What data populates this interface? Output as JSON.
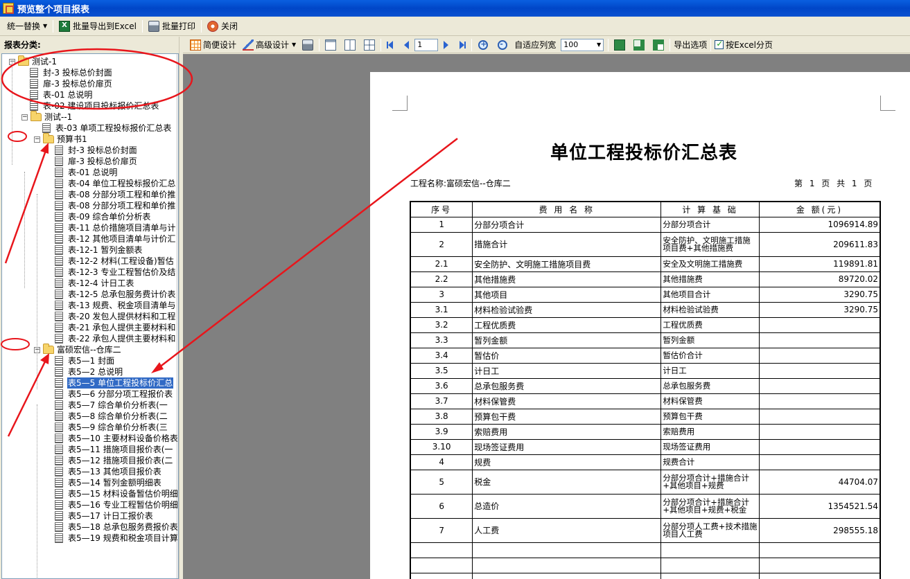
{
  "window": {
    "title": "预览整个项目报表"
  },
  "toolbar": {
    "replace_label": "统一替换",
    "export_label": "批量导出到Excel",
    "print_label": "批量打印",
    "close_label": "关闭"
  },
  "left": {
    "header": "报表分类:",
    "tree": [
      {
        "label": "测试-1",
        "level": 0,
        "type": "folder"
      },
      {
        "label": "封-3 投标总价封面",
        "level": 1,
        "type": "doc"
      },
      {
        "label": "扉-3 投标总价扉页",
        "level": 1,
        "type": "doc"
      },
      {
        "label": "表-01 总说明",
        "level": 1,
        "type": "doc"
      },
      {
        "label": "表-02 建设项目投标报价汇总表",
        "level": 1,
        "type": "doc"
      },
      {
        "label": "测试--1",
        "level": 1,
        "type": "folder"
      },
      {
        "label": "表-03 单项工程投标报价汇总表",
        "level": 2,
        "type": "doc"
      },
      {
        "label": "预算书1",
        "level": 2,
        "type": "folder"
      },
      {
        "label": "封-3 投标总价封面",
        "level": 3,
        "type": "doc"
      },
      {
        "label": "扉-3 投标总价扉页",
        "level": 3,
        "type": "doc"
      },
      {
        "label": "表-01 总说明",
        "level": 3,
        "type": "doc"
      },
      {
        "label": "表-04 单位工程投标报价汇总",
        "level": 3,
        "type": "doc"
      },
      {
        "label": "表-08 分部分项工程和单价推",
        "level": 3,
        "type": "doc"
      },
      {
        "label": "表-08 分部分项工程和单价推",
        "level": 3,
        "type": "doc"
      },
      {
        "label": "表-09 综合单价分析表",
        "level": 3,
        "type": "doc"
      },
      {
        "label": "表-11 总价措施项目清单与计",
        "level": 3,
        "type": "doc"
      },
      {
        "label": "表-12 其他项目清单与计价汇",
        "level": 3,
        "type": "doc"
      },
      {
        "label": "表-12-1 暂列金额表",
        "level": 3,
        "type": "doc"
      },
      {
        "label": "表-12-2 材料(工程设备)暂估",
        "level": 3,
        "type": "doc"
      },
      {
        "label": "表-12-3 专业工程暂估价及结",
        "level": 3,
        "type": "doc"
      },
      {
        "label": "表-12-4 计日工表",
        "level": 3,
        "type": "doc"
      },
      {
        "label": "表-12-5 总承包服务费计价表",
        "level": 3,
        "type": "doc"
      },
      {
        "label": "表-13 规费、税金项目清单与",
        "level": 3,
        "type": "doc"
      },
      {
        "label": "表-20 发包人提供材料和工程",
        "level": 3,
        "type": "doc"
      },
      {
        "label": "表-21 承包人提供主要材料和",
        "level": 3,
        "type": "doc"
      },
      {
        "label": "表-22 承包人提供主要材料和",
        "level": 3,
        "type": "doc"
      },
      {
        "label": "富硕宏信--仓库二",
        "level": 2,
        "type": "folder"
      },
      {
        "label": "表5—1 封面",
        "level": 3,
        "type": "doc"
      },
      {
        "label": "表5—2 总说明",
        "level": 3,
        "type": "doc"
      },
      {
        "label": "表5—5 单位工程投标价汇总",
        "level": 3,
        "type": "doc",
        "selected": true
      },
      {
        "label": "表5—6 分部分项工程报价表",
        "level": 3,
        "type": "doc"
      },
      {
        "label": "表5—7 综合单价分析表(一",
        "level": 3,
        "type": "doc"
      },
      {
        "label": "表5—8 综合单价分析表(二",
        "level": 3,
        "type": "doc"
      },
      {
        "label": "表5—9 综合单价分析表(三",
        "level": 3,
        "type": "doc"
      },
      {
        "label": "表5—10 主要材料设备价格表",
        "level": 3,
        "type": "doc"
      },
      {
        "label": "表5—11 措施项目报价表(一",
        "level": 3,
        "type": "doc"
      },
      {
        "label": "表5—12 措施项目报价表(二",
        "level": 3,
        "type": "doc"
      },
      {
        "label": "表5—13 其他项目报价表",
        "level": 3,
        "type": "doc"
      },
      {
        "label": "表5—14 暂列金额明细表",
        "level": 3,
        "type": "doc"
      },
      {
        "label": "表5—15 材料设备暂估价明细",
        "level": 3,
        "type": "doc"
      },
      {
        "label": "表5—16 专业工程暂估价明细",
        "level": 3,
        "type": "doc"
      },
      {
        "label": "表5—17 计日工报价表",
        "level": 3,
        "type": "doc"
      },
      {
        "label": "表5—18 总承包服务费报价表",
        "level": 3,
        "type": "doc"
      },
      {
        "label": "表5—19 规费和税金项目计算",
        "level": 3,
        "type": "doc"
      }
    ]
  },
  "preview_toolbar": {
    "simple_design": "简便设计",
    "advanced_design": "高级设计",
    "page_value": "1",
    "fit_width": "自适应列宽",
    "zoom_value": "100",
    "export_options": "导出选项",
    "excel_paging": "按Excel分页"
  },
  "report": {
    "title": "单位工程投标价汇总表",
    "project_label": "工程名称:富硕宏信--仓库二",
    "page_info": "第 1 页 共 1 页",
    "headers": [
      "序号",
      "费 用 名 称",
      "计 算 基 础",
      "金 额(元)"
    ],
    "rows": [
      {
        "no": "1",
        "name": "分部分项合计",
        "base": "分部分项合计",
        "amount": "1096914.89"
      },
      {
        "no": "2",
        "name": "措施合计",
        "base": "安全防护、文明施工措施项目费+其他措施费",
        "amount": "209611.83",
        "tall": true
      },
      {
        "no": "2.1",
        "name": "安全防护、文明施工措施项目费",
        "base": "安全及文明施工措施费",
        "amount": "119891.81"
      },
      {
        "no": "2.2",
        "name": "其他措施费",
        "base": "其他措施费",
        "amount": "89720.02"
      },
      {
        "no": "3",
        "name": "其他项目",
        "base": "其他项目合计",
        "amount": "3290.75"
      },
      {
        "no": "3.1",
        "name": "材料检验试验费",
        "base": "材料检验试验费",
        "amount": "3290.75"
      },
      {
        "no": "3.2",
        "name": "工程优质费",
        "base": "工程优质费",
        "amount": ""
      },
      {
        "no": "3.3",
        "name": "暂列金额",
        "base": "暂列金额",
        "amount": ""
      },
      {
        "no": "3.4",
        "name": "暂估价",
        "base": "暂估价合计",
        "amount": ""
      },
      {
        "no": "3.5",
        "name": "计日工",
        "base": "计日工",
        "amount": ""
      },
      {
        "no": "3.6",
        "name": "总承包服务费",
        "base": "总承包服务费",
        "amount": ""
      },
      {
        "no": "3.7",
        "name": "材料保管费",
        "base": "材料保管费",
        "amount": ""
      },
      {
        "no": "3.8",
        "name": "预算包干费",
        "base": "预算包干费",
        "amount": ""
      },
      {
        "no": "3.9",
        "name": "索赔费用",
        "base": "索赔费用",
        "amount": ""
      },
      {
        "no": "3.10",
        "name": "现场签证费用",
        "base": "现场签证费用",
        "amount": ""
      },
      {
        "no": "4",
        "name": "规费",
        "base": "规费合计",
        "amount": ""
      },
      {
        "no": "5",
        "name": "税金",
        "base": "分部分项合计+措施合计+其他项目+规费",
        "amount": "44704.07",
        "tall": true
      },
      {
        "no": "6",
        "name": "总造价",
        "base": "分部分项合计+措施合计+其他项目+规费+税金",
        "amount": "1354521.54",
        "tall": true
      },
      {
        "no": "7",
        "name": "人工费",
        "base": "分部分项人工费+技术措施项目人工费",
        "amount": "298555.18",
        "tall": true
      },
      {
        "no": "",
        "name": "",
        "base": "",
        "amount": ""
      },
      {
        "no": "",
        "name": "",
        "base": "",
        "amount": ""
      },
      {
        "no": "",
        "name": "",
        "base": "",
        "amount": ""
      }
    ]
  },
  "colors": {
    "title_bar": "#0a5fe0",
    "annotation": "#e8151b",
    "selection": "#316ac5"
  }
}
